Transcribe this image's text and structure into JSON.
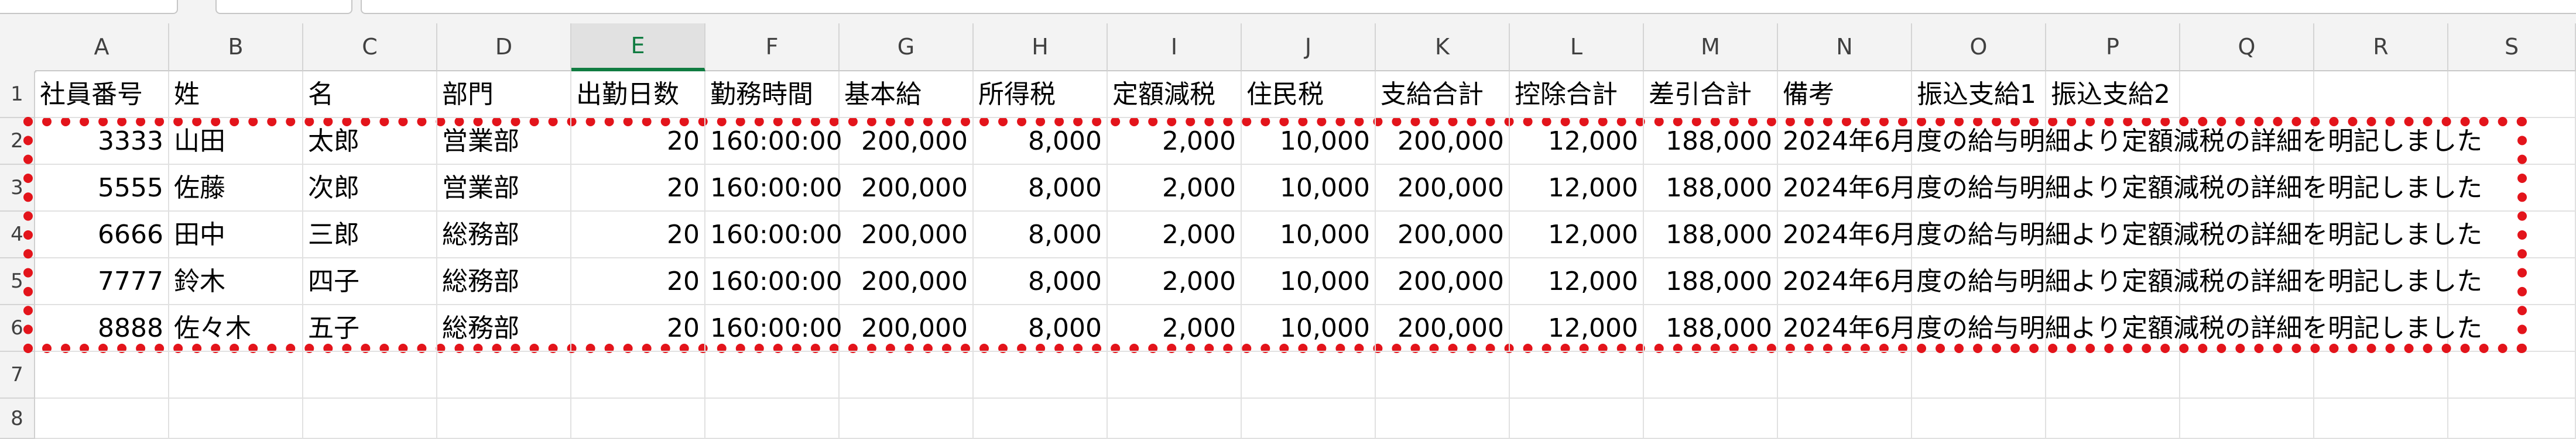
{
  "columns": [
    "A",
    "B",
    "C",
    "D",
    "E",
    "F",
    "G",
    "H",
    "I",
    "J",
    "K",
    "L",
    "M",
    "N",
    "O",
    "P",
    "Q",
    "R",
    "S"
  ],
  "active_column": "E",
  "row_numbers": [
    "1",
    "2",
    "3",
    "4",
    "5",
    "6",
    "7",
    "8"
  ],
  "header_row": [
    "社員番号",
    "姓",
    "名",
    "部門",
    "出勤日数",
    "勤務時間",
    "基本給",
    "所得税",
    "定額減税",
    "住民税",
    "支給合計",
    "控除合計",
    "差引合計",
    "備考",
    "振込支給1",
    "振込支給2"
  ],
  "data_rows": [
    [
      "3333",
      "山田",
      "太郎",
      "営業部",
      "20",
      "160:00:00",
      "200,000",
      "8,000",
      "2,000",
      "10,000",
      "200,000",
      "12,000",
      "188,000",
      "2024年6月度の給与明細より定額減税の詳細を明記しました"
    ],
    [
      "5555",
      "佐藤",
      "次郎",
      "営業部",
      "20",
      "160:00:00",
      "200,000",
      "8,000",
      "2,000",
      "10,000",
      "200,000",
      "12,000",
      "188,000",
      "2024年6月度の給与明細より定額減税の詳細を明記しました"
    ],
    [
      "6666",
      "田中",
      "三郎",
      "総務部",
      "20",
      "160:00:00",
      "200,000",
      "8,000",
      "2,000",
      "10,000",
      "200,000",
      "12,000",
      "188,000",
      "2024年6月度の給与明細より定額減税の詳細を明記しました"
    ],
    [
      "7777",
      "鈴木",
      "四子",
      "総務部",
      "20",
      "160:00:00",
      "200,000",
      "8,000",
      "2,000",
      "10,000",
      "200,000",
      "12,000",
      "188,000",
      "2024年6月度の給与明細より定額減税の詳細を明記しました"
    ],
    [
      "8888",
      "佐々木",
      "五子",
      "総務部",
      "20",
      "160:00:00",
      "200,000",
      "8,000",
      "2,000",
      "10,000",
      "200,000",
      "12,000",
      "188,000",
      "2024年6月度の給与明細より定額減税の詳細を明記しました"
    ]
  ],
  "highlight_color": "#e3141b",
  "accent_color": "#107c41"
}
